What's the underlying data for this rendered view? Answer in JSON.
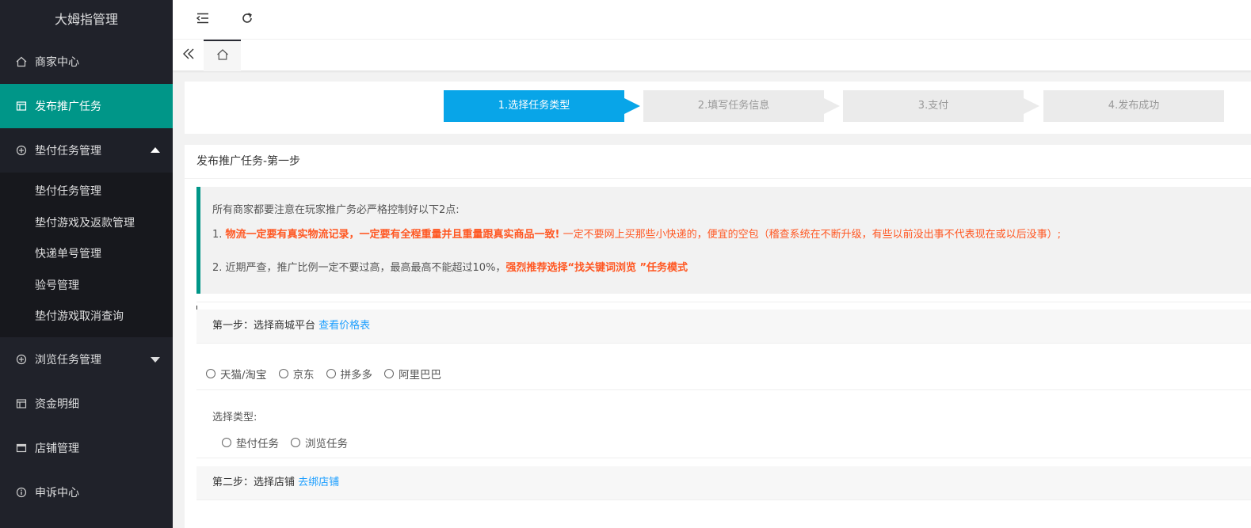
{
  "sidebar": {
    "brand": "大姆指管理",
    "items": [
      {
        "label": "商家中心",
        "icon": "home-icon"
      },
      {
        "label": "发布推广任务",
        "icon": "layout-icon"
      },
      {
        "label": "垫付任务管理",
        "icon": "add-circle-icon"
      },
      {
        "label": "浏览任务管理",
        "icon": "add-circle-icon"
      },
      {
        "label": "资金明细",
        "icon": "layout-icon"
      },
      {
        "label": "店铺管理",
        "icon": "window-icon"
      },
      {
        "label": "申诉中心",
        "icon": "info-icon"
      }
    ],
    "sub_items": [
      "垫付任务管理",
      "垫付游戏及返款管理",
      "快递单号管理",
      "验号管理",
      "垫付游戏取消查询"
    ]
  },
  "header": {
    "collapse_icon": "menu-collapse-icon",
    "refresh_icon": "refresh-icon"
  },
  "tabs": {
    "prev_icon": "double-chevron-left-icon",
    "home_icon": "home-icon"
  },
  "steps": [
    "1.选择任务类型",
    "2.填写任务信息",
    "3.支付",
    "4.发布成功"
  ],
  "card": {
    "title": "发布推广任务-第一步",
    "notice_intro": "所有商家都要注意在玩家推广务必严格控制好以下2点:",
    "notice_1_prefix": "1. ",
    "notice_1_bold": "物流一定要有真实物流记录，一定要有全程重量并且重量跟真实商品一致!",
    "notice_1_rest": " 一定不要网上买那些小快递的，便宜的空包（稽查系统在不断升级，有些以前没出事不代表现在或以后没事）;",
    "notice_2_normal": "2. 近期严查，推广比例一定不要过高，最高最高不能超过10%，",
    "notice_2_bold": "强烈推荐选择“找关键词浏览 ”任务模式"
  },
  "step1": {
    "label": "第一步：选择商城平台",
    "link": "查看价格表",
    "platforms": [
      "天猫/淘宝",
      "京东",
      "拼多多",
      "阿里巴巴"
    ]
  },
  "type_select": {
    "label": "选择类型:",
    "options": [
      "垫付任务",
      "浏览任务"
    ]
  },
  "step2": {
    "label": "第二步：选择店铺",
    "link": "去绑店铺"
  }
}
